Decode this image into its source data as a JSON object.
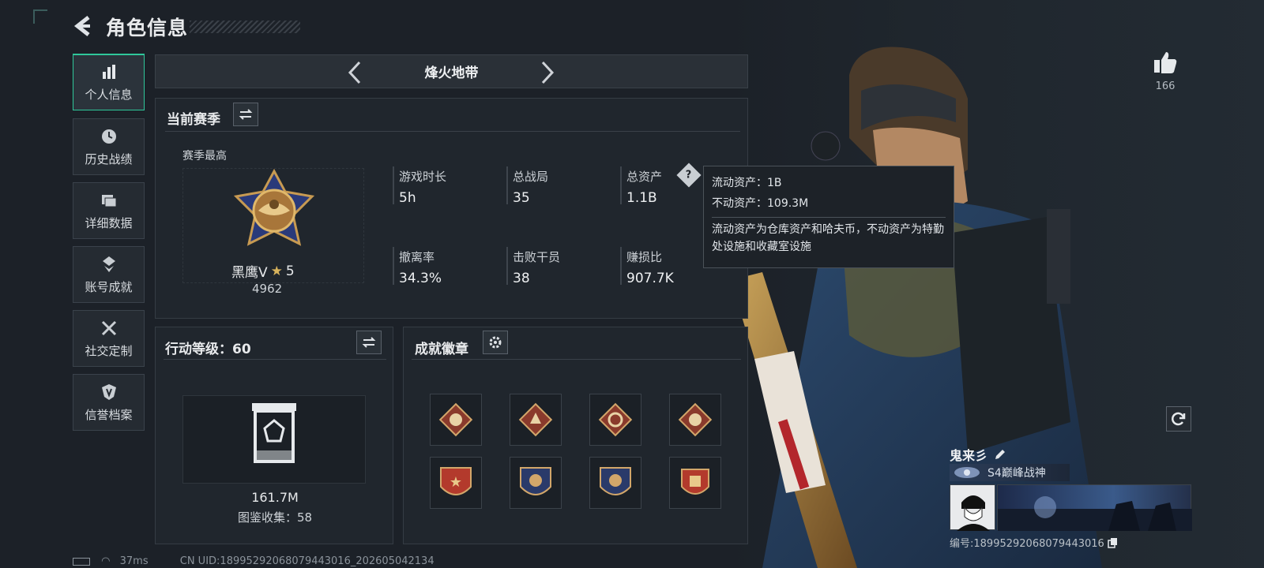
{
  "header": {
    "title": "角色信息"
  },
  "nav": [
    {
      "label": "个人信息",
      "icon": "bar-chart-icon"
    },
    {
      "label": "历史战绩",
      "icon": "clock-icon"
    },
    {
      "label": "详细数据",
      "icon": "folder-icon"
    },
    {
      "label": "账号成就",
      "icon": "medal-icon"
    },
    {
      "label": "社交定制",
      "icon": "tools-icon"
    },
    {
      "label": "信誉档案",
      "icon": "shield-icon"
    }
  ],
  "tab": {
    "name": "烽火地带"
  },
  "season": {
    "title": "当前赛季",
    "best_label": "赛季最高",
    "rank_name": "黑鹰V",
    "rank_stars": "5",
    "rank_score": "4962",
    "stats": [
      {
        "label": "游戏时长",
        "value": "5h"
      },
      {
        "label": "总战局",
        "value": "35"
      },
      {
        "label": "总资产",
        "value": "1.1B"
      },
      {
        "label": "撤离率",
        "value": "34.3%"
      },
      {
        "label": "击败干员",
        "value": "38"
      },
      {
        "label": "赚损比",
        "value": "907.7K"
      }
    ]
  },
  "tooltip": {
    "line1": "流动资产：1B",
    "line2": "不动资产：109.3M",
    "desc": "流动资产为仓库资产和哈夫币，不动资产为特勤处设施和收藏室设施"
  },
  "level": {
    "title": "行动等级：60",
    "value": "161.7M",
    "collection": "图鉴收集：58"
  },
  "badges": {
    "title": "成就徽章"
  },
  "like": {
    "count": "166"
  },
  "player": {
    "name": "鬼来彡",
    "title": "S4巅峰战神",
    "id": "编号:18995292068079443016"
  },
  "status": {
    "ping": "37ms",
    "uid": "CN UID:18995292068079443016_202605042134"
  },
  "colors": {
    "accent": "#2fc79a",
    "bg": "#1c2128",
    "panel": "#20262d"
  }
}
